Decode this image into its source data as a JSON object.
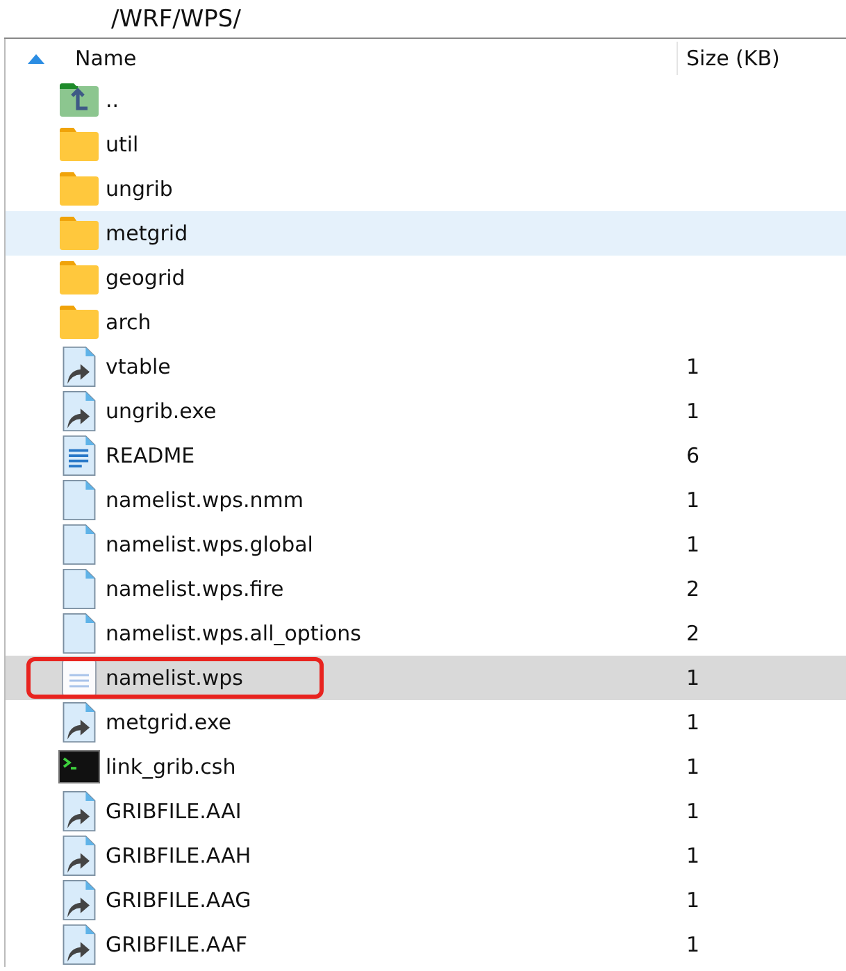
{
  "path": "/WRF/WPS/",
  "columns": [
    {
      "label": "Name",
      "sorted": true
    },
    {
      "label": "Size (KB)",
      "sorted": false
    }
  ],
  "rows": [
    {
      "kind": "parent",
      "name": "..",
      "size": "",
      "hovered": false,
      "selected": false,
      "highlighted": false
    },
    {
      "kind": "folder",
      "name": "util",
      "size": "",
      "hovered": false,
      "selected": false,
      "highlighted": false
    },
    {
      "kind": "folder",
      "name": "ungrib",
      "size": "",
      "hovered": false,
      "selected": false,
      "highlighted": false
    },
    {
      "kind": "folder",
      "name": "metgrid",
      "size": "",
      "hovered": true,
      "selected": false,
      "highlighted": false
    },
    {
      "kind": "folder",
      "name": "geogrid",
      "size": "",
      "hovered": false,
      "selected": false,
      "highlighted": false
    },
    {
      "kind": "folder",
      "name": "arch",
      "size": "",
      "hovered": false,
      "selected": false,
      "highlighted": false
    },
    {
      "kind": "link",
      "name": "vtable",
      "size": "1",
      "hovered": false,
      "selected": false,
      "highlighted": false
    },
    {
      "kind": "link",
      "name": "ungrib.exe",
      "size": "1",
      "hovered": false,
      "selected": false,
      "highlighted": false
    },
    {
      "kind": "text",
      "name": "README",
      "size": "6",
      "hovered": false,
      "selected": false,
      "highlighted": false
    },
    {
      "kind": "file",
      "name": "namelist.wps.nmm",
      "size": "1",
      "hovered": false,
      "selected": false,
      "highlighted": false
    },
    {
      "kind": "file",
      "name": "namelist.wps.global",
      "size": "1",
      "hovered": false,
      "selected": false,
      "highlighted": false
    },
    {
      "kind": "file",
      "name": "namelist.wps.fire",
      "size": "2",
      "hovered": false,
      "selected": false,
      "highlighted": false
    },
    {
      "kind": "file",
      "name": "namelist.wps.all_options",
      "size": "2",
      "hovered": false,
      "selected": false,
      "highlighted": false
    },
    {
      "kind": "doc",
      "name": "namelist.wps",
      "size": "1",
      "hovered": false,
      "selected": true,
      "highlighted": true
    },
    {
      "kind": "link",
      "name": "metgrid.exe",
      "size": "1",
      "hovered": false,
      "selected": false,
      "highlighted": false
    },
    {
      "kind": "terminal",
      "name": "link_grib.csh",
      "size": "1",
      "hovered": false,
      "selected": false,
      "highlighted": false
    },
    {
      "kind": "link",
      "name": "GRIBFILE.AAI",
      "size": "1",
      "hovered": false,
      "selected": false,
      "highlighted": false
    },
    {
      "kind": "link",
      "name": "GRIBFILE.AAH",
      "size": "1",
      "hovered": false,
      "selected": false,
      "highlighted": false
    },
    {
      "kind": "link",
      "name": "GRIBFILE.AAG",
      "size": "1",
      "hovered": false,
      "selected": false,
      "highlighted": false
    },
    {
      "kind": "link",
      "name": "GRIBFILE.AAF",
      "size": "1",
      "hovered": false,
      "selected": false,
      "highlighted": false
    }
  ]
}
